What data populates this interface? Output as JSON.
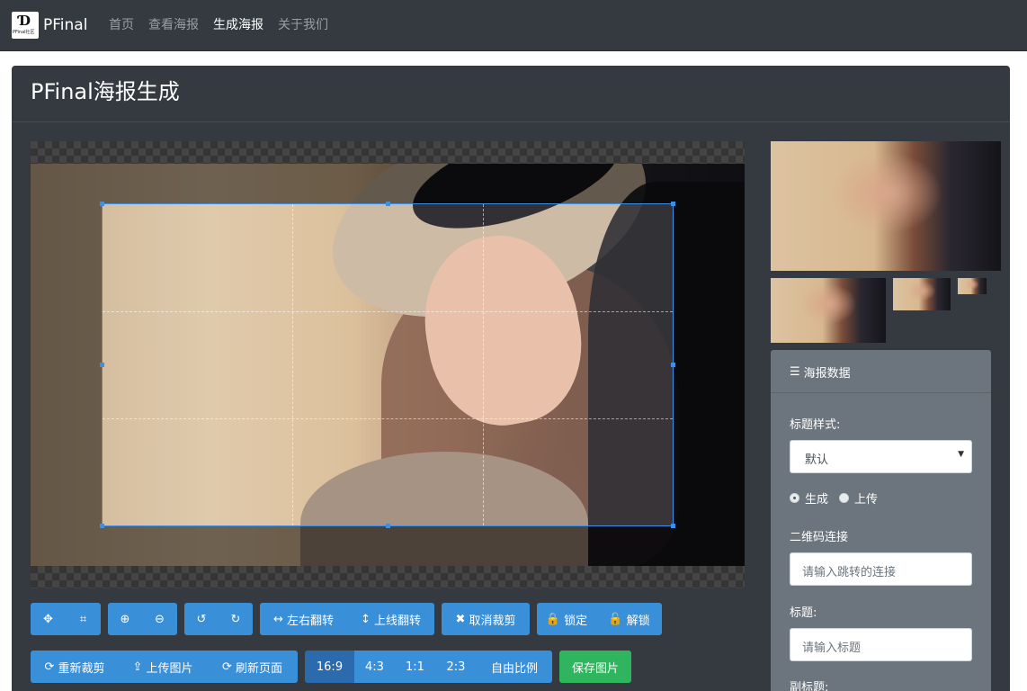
{
  "navbar": {
    "brand": "PFinal",
    "logo_subtext": "PFinal社区",
    "links": [
      {
        "label": "首页",
        "active": false
      },
      {
        "label": "查看海报",
        "active": false
      },
      {
        "label": "生成海报",
        "active": true
      },
      {
        "label": "关于我们",
        "active": false
      }
    ]
  },
  "page": {
    "title": "PFinal海报生成"
  },
  "toolbar": {
    "row1": [
      [
        {
          "icon": "move-icon",
          "glyph": "✥",
          "label": ""
        },
        {
          "icon": "crop-icon",
          "glyph": "⌗",
          "label": ""
        }
      ],
      [
        {
          "icon": "zoom-in-icon",
          "glyph": "⊕",
          "label": ""
        },
        {
          "icon": "zoom-out-icon",
          "glyph": "⊖",
          "label": ""
        }
      ],
      [
        {
          "icon": "rotate-left-icon",
          "glyph": "↺",
          "label": ""
        },
        {
          "icon": "rotate-right-icon",
          "glyph": "↻",
          "label": ""
        }
      ],
      [
        {
          "icon": "flip-horizontal-icon",
          "glyph": "↔",
          "label": "左右翻转"
        },
        {
          "icon": "flip-vertical-icon",
          "glyph": "↕",
          "label": "上线翻转"
        }
      ],
      [
        {
          "icon": "close-icon",
          "glyph": "✖",
          "label": "取消裁剪"
        }
      ],
      [
        {
          "icon": "lock-icon",
          "glyph": "🔒",
          "label": "锁定"
        },
        {
          "icon": "unlock-icon",
          "glyph": "🔓",
          "label": "解锁"
        }
      ]
    ],
    "row2_actions": [
      {
        "icon": "refresh-icon",
        "glyph": "⟳",
        "label": "重新裁剪"
      },
      {
        "icon": "upload-icon",
        "glyph": "⇪",
        "label": "上传图片"
      },
      {
        "icon": "reload-icon",
        "glyph": "⟳",
        "label": "刷新页面"
      }
    ],
    "ratios": [
      {
        "label": "16:9",
        "active": true
      },
      {
        "label": "4:3",
        "active": false
      },
      {
        "label": "1:1",
        "active": false
      },
      {
        "label": "2:3",
        "active": false
      },
      {
        "label": "自由比例",
        "active": false
      }
    ],
    "save_label": "保存图片"
  },
  "panel": {
    "title": "海报数据",
    "title_style_label": "标题样式:",
    "title_style_value": "默认",
    "radio_generate": "生成",
    "radio_upload": "上传",
    "radio_selected": "生成",
    "qr_label": "二维码连接",
    "qr_placeholder": "请输入跳转的连接",
    "title_label": "标题:",
    "title_placeholder": "请输入标题",
    "subtitle_label": "副标题:"
  },
  "colors": {
    "navbar_bg": "#343a40",
    "primary_button": "#3a8fd9",
    "success_button": "#2fb55e",
    "panel_bg": "#6c757d",
    "crop_border": "#3d8fe6"
  }
}
